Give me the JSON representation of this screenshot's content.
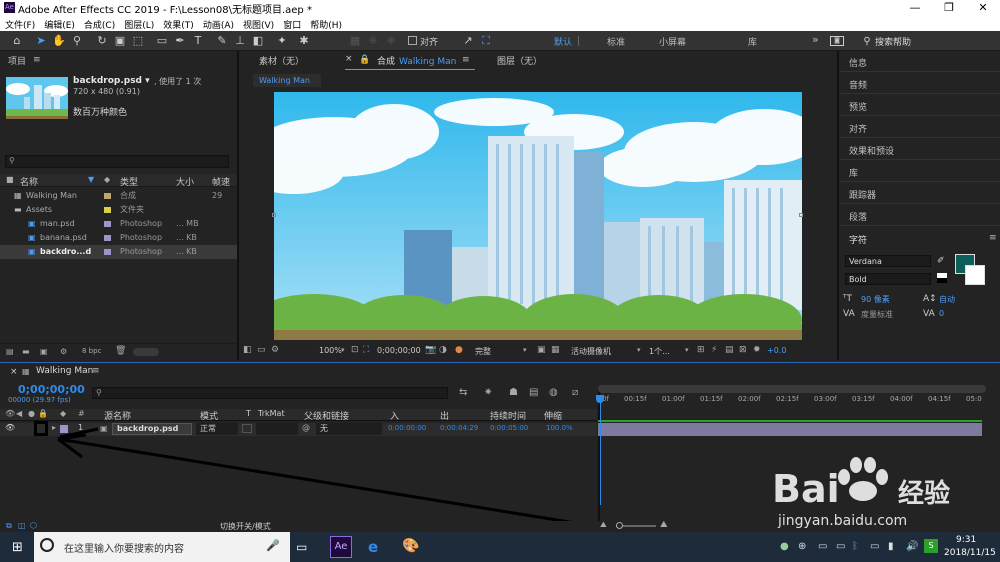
{
  "window": {
    "title": "Adobe After Effects CC 2019 - F:\\Lesson08\\无标题项目.aep *",
    "app_icon": "Ae",
    "minimize": "—",
    "maximize": "❐",
    "close": "✕"
  },
  "menu": [
    "文件(F)",
    "编辑(E)",
    "合成(C)",
    "图层(L)",
    "效果(T)",
    "动画(A)",
    "视图(V)",
    "窗口",
    "帮助(H)"
  ],
  "toolbar": {
    "align_label": "对齐",
    "workspaces": [
      "默认",
      "标准",
      "小屏幕",
      "库"
    ],
    "more": "»",
    "search_placeholder": "搜索帮助"
  },
  "project": {
    "title": "项目",
    "asset_name": "backdrop.psd ▾",
    "used": ", 使用了 1 次",
    "dims": "720 x 480 (0.91)",
    "colors": "数百万种颜色",
    "columns": {
      "name": "名称",
      "type": "类型",
      "size": "大小",
      "frame": "帧速"
    },
    "items": [
      {
        "name": "Walking Man",
        "type": "合成",
        "size": "",
        "fps": "29",
        "indent": 0,
        "swatch": "#c0a66b",
        "icon": "comp-icon"
      },
      {
        "name": "Assets",
        "type": "文件夹",
        "size": "",
        "fps": "",
        "indent": 0,
        "swatch": "#d9cf4a",
        "icon": "folder-icon"
      },
      {
        "name": "man.psd",
        "type": "Photoshop",
        "size": "... MB",
        "fps": "",
        "indent": 1,
        "swatch": "#9c95c8",
        "icon": "psd-icon"
      },
      {
        "name": "banana.psd",
        "type": "Photoshop",
        "size": "... KB",
        "fps": "",
        "indent": 1,
        "swatch": "#9c95c8",
        "icon": "psd-icon"
      },
      {
        "name": "backdro...d",
        "type": "Photoshop",
        "size": "... KB",
        "fps": "",
        "indent": 1,
        "swatch": "#9c95c8",
        "icon": "psd-icon"
      }
    ],
    "bpc": "8 bpc"
  },
  "viewer": {
    "tabs": {
      "footage": "素材（无）",
      "comp_prefix": "合成",
      "comp_name": "Walking Man",
      "layer": "图层（无）"
    },
    "breadcrumb": "Walking Man",
    "bottom": {
      "zoom": "100%",
      "timecode": "0;00;00;00",
      "quality": "完整",
      "camera": "活动摄像机",
      "views": "1个...",
      "exposure": "+0.0"
    }
  },
  "right_panel": {
    "items": [
      "信息",
      "音频",
      "预览",
      "对齐",
      "效果和预设",
      "库",
      "跟踪器",
      "段落",
      "字符"
    ],
    "font": "Verdana",
    "style": "Bold",
    "font_size": "90 像素",
    "leading": "自动",
    "kerning": "度量标准",
    "tracking": "0",
    "fill_color": "#0e5e5a"
  },
  "timeline": {
    "tab": "Walking Man",
    "timecode": "0;00;00;00",
    "fps_line": "00000 (29.97 fps)",
    "headers": {
      "name": "源名称",
      "mode": "模式",
      "t": "T",
      "trkmat": "TrkMat",
      "parent": "父级和链接",
      "in": "入",
      "out": "出",
      "duration": "持续时间",
      "stretch": "伸缩"
    },
    "layer": {
      "num": "1",
      "name": "backdrop.psd",
      "mode": "正常",
      "parent": "无",
      "in": "0:00:00:00",
      "out": "0:00:04:29",
      "duration": "0:00:05:00",
      "stretch": "100.0%"
    },
    "ruler": [
      "0f",
      "00:15f",
      "01:00f",
      "01:15f",
      "02:00f",
      "02:15f",
      "03:00f",
      "03:15f",
      "04:00f",
      "04:15f",
      "05:0"
    ],
    "footer": "切换开关/模式"
  },
  "taskbar": {
    "search": "在这里输入你要搜索的内容",
    "time": "9:31",
    "date": "2018/11/15"
  },
  "watermark": {
    "brand": "Bai",
    "brand2": "经验",
    "url": "jingyan.baidu.com"
  }
}
